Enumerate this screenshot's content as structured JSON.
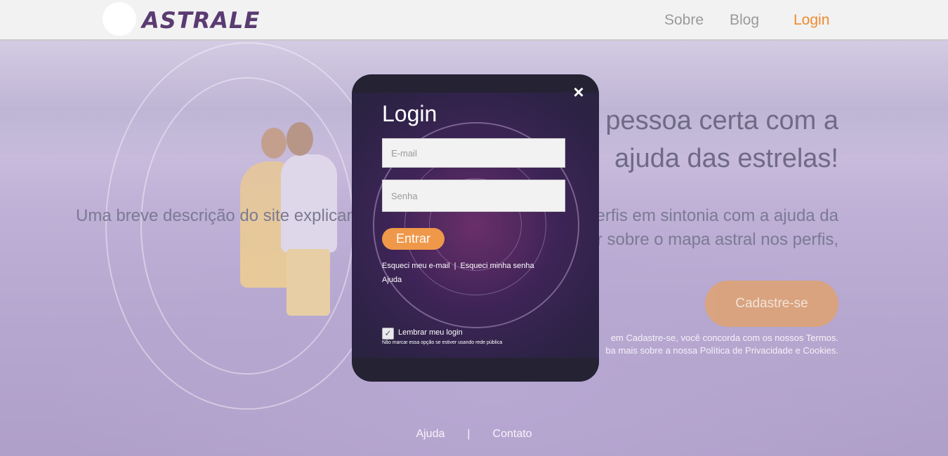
{
  "header": {
    "logo_text": "ASTRALE",
    "nav": {
      "sobre": "Sobre",
      "blog": "Blog",
      "login": "Login"
    }
  },
  "hero": {
    "title_line1": "pessoa certa com a",
    "title_line2": "ajuda das estrelas!",
    "desc_left": "Uma breve descrição do site explicand",
    "desc_right_line1": "erfis em sintonia com a ajuda da",
    "desc_right_line2": "r sobre o mapa astral nos perfis,",
    "signup_label": "Cadastre-se",
    "terms_line1": "em Cadastre-se, você concorda com os nossos Termos.",
    "terms_line2": "ba mais sobre a nossa Política de Privacidade e Cookies."
  },
  "footer": {
    "help": "Ajuda",
    "separator": "|",
    "contact": "Contato"
  },
  "login_modal": {
    "title": "Login",
    "close_icon": "×",
    "email_placeholder": "E-mail",
    "password_placeholder": "Senha",
    "enter_label": "Entrar",
    "forgot_email": "Esqueci meu e-mail",
    "link_separator": "|",
    "forgot_password": "Esqueci minha senha",
    "help": "Ajuda",
    "remember_checked": true,
    "remember_check_glyph": "✓",
    "remember_label": "Lembrar meu login",
    "remember_note": "Não marcar essa opção se estiver usando rede pública"
  },
  "colors": {
    "accent_orange": "#f08a30",
    "button_orange": "#f0984a",
    "modal_bg": "#252233",
    "logo_purple": "#5a3b72"
  }
}
